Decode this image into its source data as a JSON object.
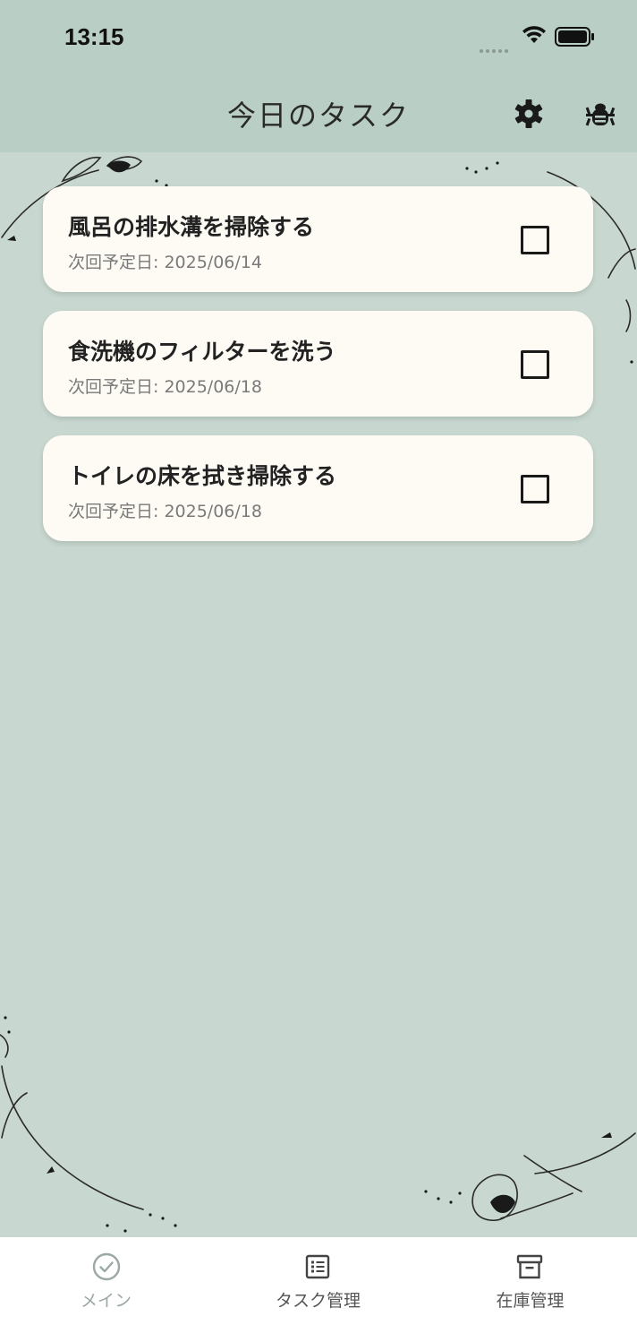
{
  "status_bar": {
    "time": "13:15"
  },
  "app_bar": {
    "title": "今日のタスク",
    "settings_icon": "gear-icon",
    "debug_icon": "bug-icon"
  },
  "tasks": [
    {
      "title": "風呂の排水溝を掃除する",
      "date": "次回予定日: 2025/06/14",
      "done": false
    },
    {
      "title": "食洗機のフィルターを洗う",
      "date": "次回予定日: 2025/06/18",
      "done": false
    },
    {
      "title": "トイレの床を拭き掃除する",
      "date": "次回予定日: 2025/06/18",
      "done": false
    }
  ],
  "tab_bar": {
    "active": "main",
    "items": [
      {
        "label": "メイン",
        "icon": "check-circle-icon"
      },
      {
        "label": "タスク管理",
        "icon": "list-icon"
      },
      {
        "label": "在庫管理",
        "icon": "archive-box-icon"
      }
    ]
  },
  "colors": {
    "background": "#c8d8d0",
    "app_bar": "#b9cfc5",
    "card": "#fdfbf4",
    "tab_active": "#9aa9a1"
  }
}
